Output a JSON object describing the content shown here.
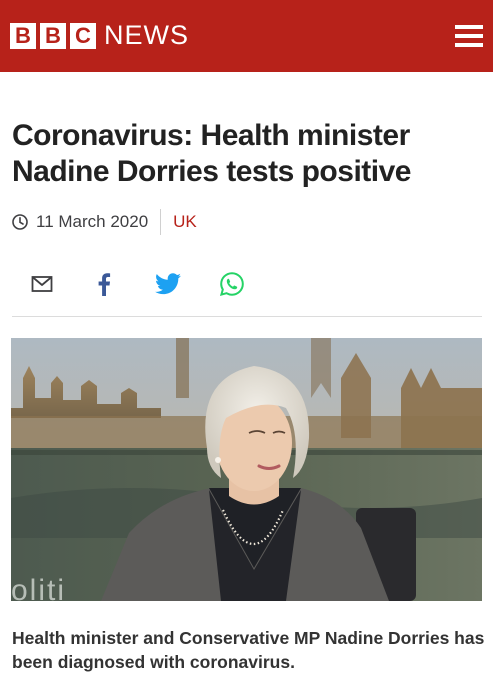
{
  "header": {
    "logo_letters": [
      "B",
      "B",
      "C"
    ],
    "logo_news": "NEWS",
    "background_color": "#b7221a",
    "menu_icon": "hamburger-menu-icon"
  },
  "article": {
    "headline": "Coronavirus: Health minister Nadine Dorries tests positive",
    "date": "11 March 2020",
    "category": "UK",
    "category_color": "#b7221a",
    "share_icons": [
      "email-icon",
      "facebook-icon",
      "twitter-icon",
      "whatsapp-icon"
    ],
    "image_overlay_text": "oliti",
    "caption": "Health minister and Conservative MP Nadine Dorries has been diagnosed with coronavirus."
  }
}
